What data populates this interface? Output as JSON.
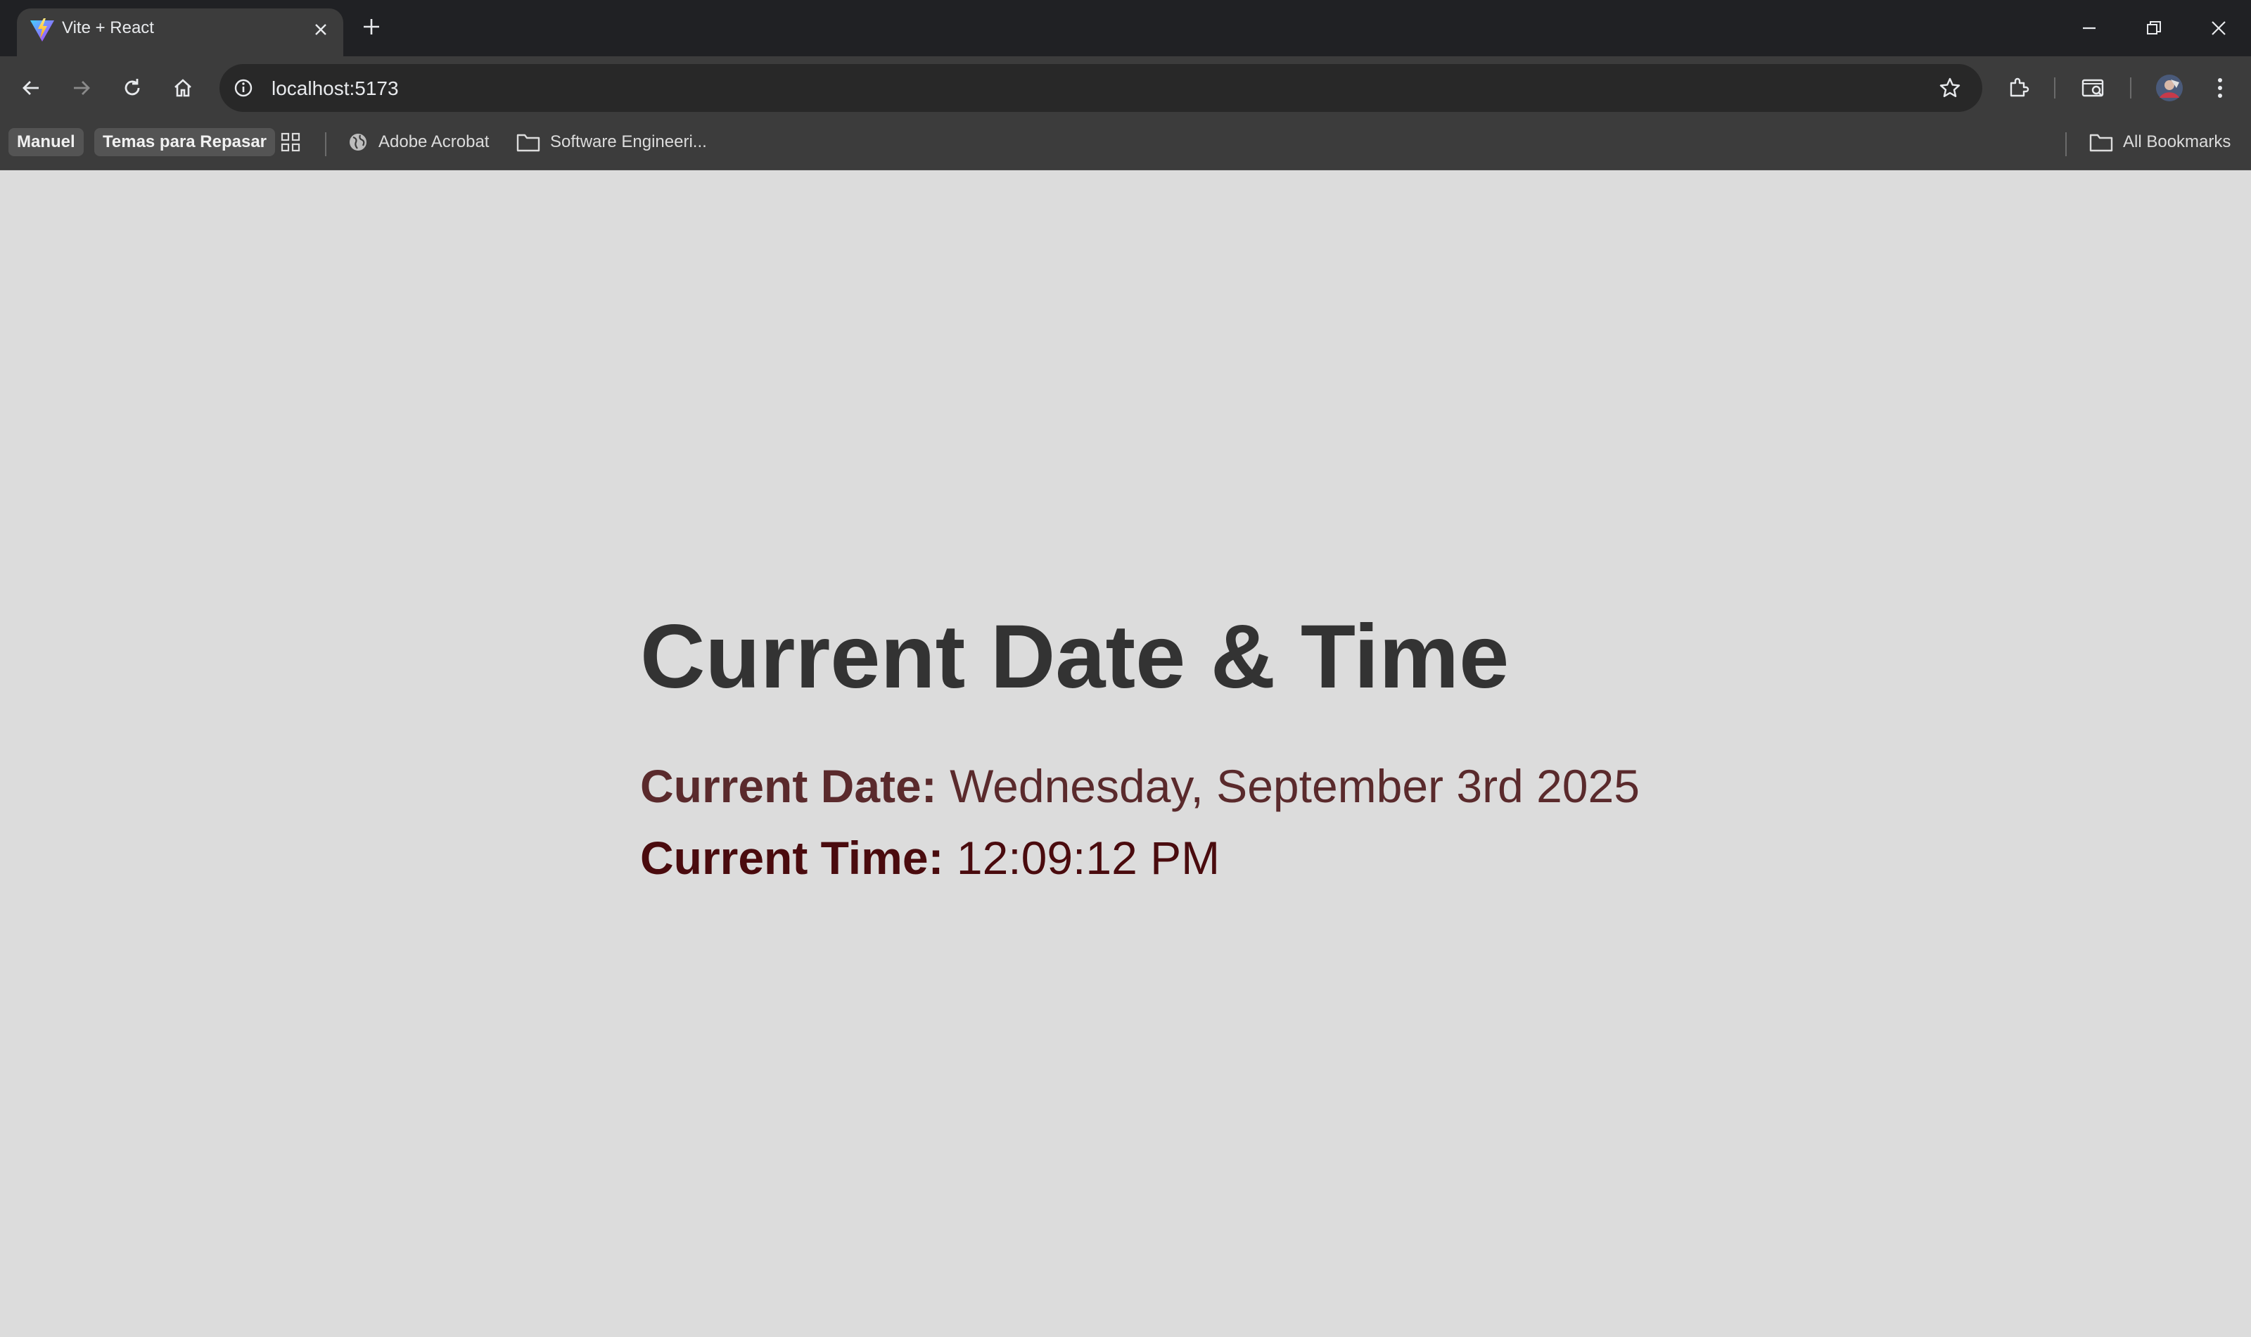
{
  "browser": {
    "tab": {
      "title": "Vite + React"
    },
    "address_bar": {
      "url": "localhost:5173"
    },
    "bookmarks": [
      {
        "label": "Manuel",
        "type": "chip"
      },
      {
        "label": "Temas para Repasar",
        "type": "chip"
      },
      {
        "label": "Adobe Acrobat",
        "type": "site",
        "icon": "globe-icon"
      },
      {
        "label": "Software Engineeri...",
        "type": "folder",
        "icon": "folder-icon"
      }
    ],
    "all_bookmarks_label": "All Bookmarks"
  },
  "page": {
    "title": "Current Date & Time",
    "date_label": "Current Date:",
    "date_value": "Wednesday, September 3rd 2025",
    "time_label": "Current Time:",
    "time_value": "12:09:12 PM"
  },
  "colors": {
    "page_background": "#dcdcdc",
    "title_color": "#333333",
    "date_color": "#5a2a2c",
    "time_color": "#4a0b0e",
    "browser_frame": "#202124",
    "toolbar": "#3c3c3c"
  }
}
